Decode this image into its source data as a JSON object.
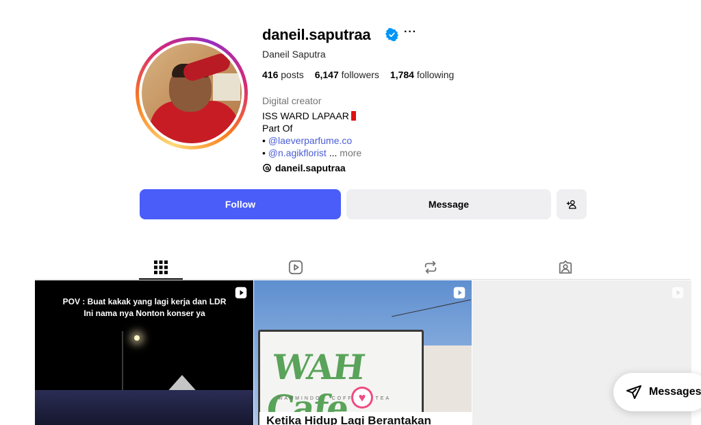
{
  "profile": {
    "username": "daneil.saputraa",
    "full_name": "Daneil Saputra",
    "verified": true,
    "stats": {
      "posts_count": "416",
      "posts_label": "posts",
      "followers_count": "6,147",
      "followers_label": "followers",
      "following_count": "1,784",
      "following_label": "following"
    },
    "category": "Digital creator",
    "bio": {
      "line1": "ISS WARD LAPAAR",
      "line2": "Part Of",
      "line3_bullet": "• ",
      "line3_link": "@laeverparfume.co",
      "line4_bullet": "• ",
      "line4_link": "@n.agikflorist",
      "line4_ellipsis": " ... ",
      "more": "more"
    },
    "threads_handle": "daneil.saputraa"
  },
  "actions": {
    "follow": "Follow",
    "message": "Message"
  },
  "tabs": [
    {
      "name": "posts",
      "icon": "grid-icon",
      "active": true
    },
    {
      "name": "reels",
      "icon": "reels-icon",
      "active": false
    },
    {
      "name": "reposts",
      "icon": "repost-icon",
      "active": false
    },
    {
      "name": "tagged",
      "icon": "tagged-icon",
      "active": false
    }
  ],
  "posts": [
    {
      "caption": "POV : Buat kakak yang lagi kerja dan LDR\nIni nama nya Nonton konser ya",
      "type": "reel"
    },
    {
      "sign_text": "WAH Cafe",
      "sign_small": "WARMINDO · COFFEE & TEA",
      "overlay": "Ketika Hidup Lagi Berantakan",
      "type": "reel"
    },
    {
      "type": "reel"
    }
  ],
  "floating": {
    "messages_label": "Messages"
  },
  "colors": {
    "follow_bg": "#4a5df9",
    "link": "#4a5dd6",
    "verified": "#0095f6"
  }
}
